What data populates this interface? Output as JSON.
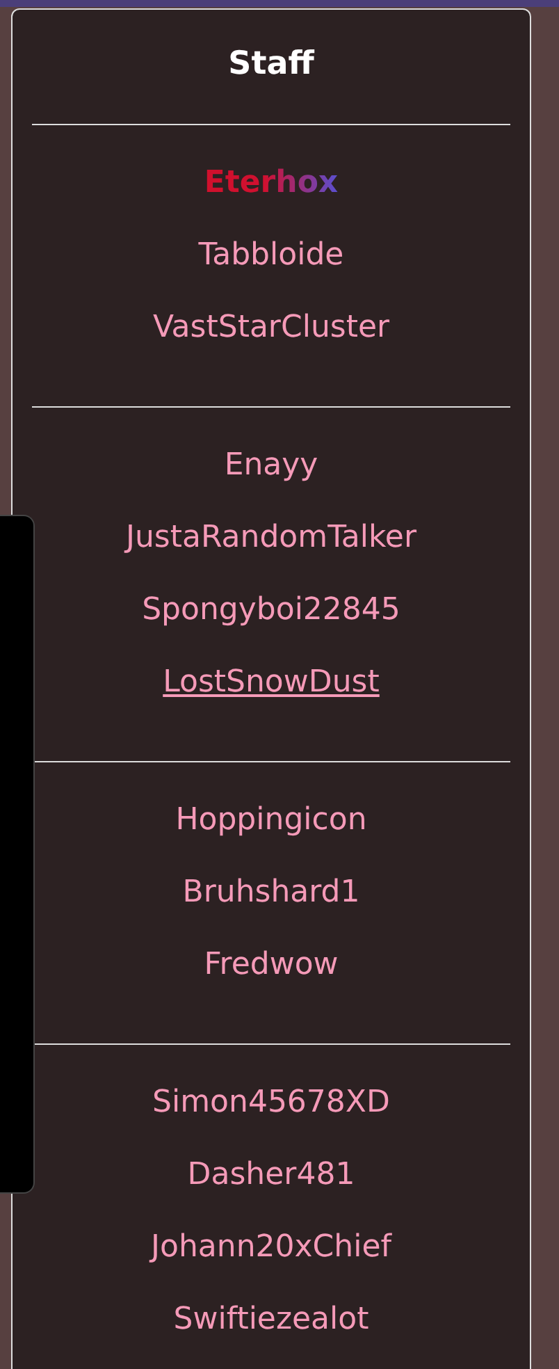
{
  "panel": {
    "title": "Staff",
    "groups": [
      {
        "members": [
          {
            "name": "Eterhox",
            "kind": "gradient",
            "underlined": false
          },
          {
            "name": "Tabbloide",
            "kind": "plain",
            "underlined": false
          },
          {
            "name": "VastStarCluster",
            "kind": "plain",
            "underlined": false
          }
        ]
      },
      {
        "members": [
          {
            "name": "Enayy",
            "kind": "plain",
            "underlined": false
          },
          {
            "name": "JustaRandomTalker",
            "kind": "plain",
            "underlined": false
          },
          {
            "name": "Spongyboi22845",
            "kind": "plain",
            "underlined": false
          },
          {
            "name": "LostSnowDust",
            "kind": "plain",
            "underlined": true
          }
        ]
      },
      {
        "members": [
          {
            "name": "Hoppingicon",
            "kind": "plain",
            "underlined": false
          },
          {
            "name": "Bruhshard1",
            "kind": "plain",
            "underlined": false
          },
          {
            "name": "Fredwow",
            "kind": "plain",
            "underlined": false
          }
        ]
      },
      {
        "members": [
          {
            "name": "Simon45678XD",
            "kind": "plain",
            "underlined": false
          },
          {
            "name": "Dasher481",
            "kind": "plain",
            "underlined": false
          },
          {
            "name": "Johann20xChief",
            "kind": "plain",
            "underlined": false
          },
          {
            "name": "Swiftiezealot",
            "kind": "plain",
            "underlined": false
          }
        ]
      }
    ]
  }
}
